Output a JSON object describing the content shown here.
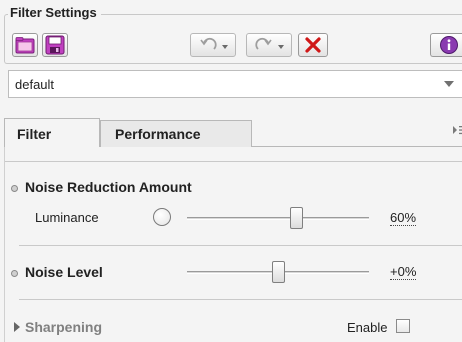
{
  "group": {
    "title": "Filter Settings"
  },
  "toolbar": {
    "open_icon": "folder-open-icon",
    "save_icon": "floppy-save-icon",
    "undo_icon": "undo-icon",
    "redo_icon": "redo-icon",
    "delete_icon": "red-x-delete-icon",
    "info_icon": "info-icon"
  },
  "preset": {
    "selected": "default"
  },
  "tabs": [
    {
      "label": "Filter",
      "active": true
    },
    {
      "label": "Performance",
      "active": false
    }
  ],
  "noise_reduction": {
    "title": "Noise Reduction Amount",
    "luminance_label": "Luminance",
    "luminance_value_text": "60%",
    "luminance_fraction": 0.6
  },
  "noise_level": {
    "title": "Noise Level",
    "value_text": "+0%",
    "fraction": 0.5
  },
  "sharpening": {
    "title": "Sharpening",
    "enable_label": "Enable",
    "enabled": false
  },
  "colors": {
    "folder": "#c040c0",
    "delete_red": "#d01818",
    "info_purple": "#8a3ab0",
    "disabled_text": "#808080"
  }
}
